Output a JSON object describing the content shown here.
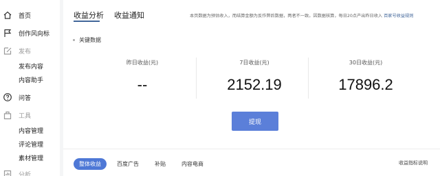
{
  "sidebar": {
    "items": [
      {
        "label": "首页",
        "icon": "home-icon",
        "kind": "item"
      },
      {
        "label": "创作风向标",
        "icon": "flag-icon",
        "kind": "item"
      },
      {
        "label": "发布",
        "icon": "edit-icon",
        "kind": "group"
      },
      {
        "label": "发布内容",
        "kind": "sub"
      },
      {
        "label": "内容助手",
        "kind": "sub"
      },
      {
        "label": "问答",
        "icon": "question-icon",
        "kind": "item"
      },
      {
        "label": "工具",
        "icon": "toolbox-icon",
        "kind": "group"
      },
      {
        "label": "内容管理",
        "kind": "sub"
      },
      {
        "label": "评论管理",
        "kind": "sub"
      },
      {
        "label": "素材管理",
        "kind": "sub"
      },
      {
        "label": "分析",
        "icon": "analysis-icon",
        "kind": "group"
      }
    ]
  },
  "header": {
    "tabs": [
      {
        "label": "收益分析",
        "active": true
      },
      {
        "label": "收益通知",
        "active": false
      }
    ],
    "notice_text": "本页数据为预估收入，而结算金额为反作弊后数据，两者不一致。因数据核算，每日20点产出昨日收入",
    "notice_link": "百家号收益规则"
  },
  "section": {
    "title": "关键数据"
  },
  "stats": [
    {
      "label": "昨日收益(元)",
      "value": "--"
    },
    {
      "label": "7日收益(元)",
      "value": "2152.19"
    },
    {
      "label": "30日收益(元)",
      "value": "17896.2"
    }
  ],
  "actions": {
    "withdraw_label": "提现"
  },
  "subtabs": [
    {
      "label": "整体收益",
      "active": true
    },
    {
      "label": "百度广告",
      "active": false
    },
    {
      "label": "补贴",
      "active": false
    },
    {
      "label": "内容电商",
      "active": false
    }
  ],
  "metric_help_label": "收益指标说明",
  "colors": {
    "accent": "#5b7fd9",
    "tab_underline": "#406599",
    "link": "#406599"
  }
}
